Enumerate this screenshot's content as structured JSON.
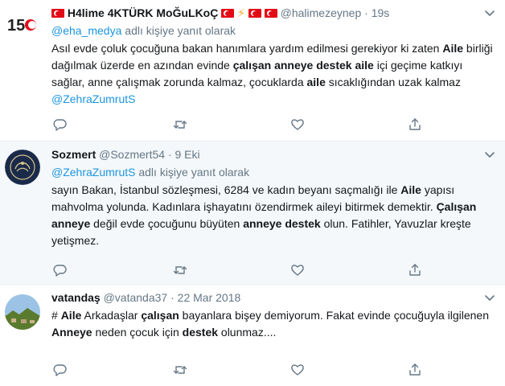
{
  "tweets": [
    {
      "name": "H4lime 4KTÜRK MoĞuLKoÇ",
      "handle": "@halimezeynep",
      "sep": "·",
      "time": "19s",
      "reply_prefix": "@eha_medya",
      "reply_suffix": " adlı kişiye yanıt olarak",
      "body": [
        {
          "t": "Asıl evde çoluk çocuğuna bakan hanımlara yardım edilmesi gerekiyor ki zaten "
        },
        {
          "b": "Aile"
        },
        {
          "t": " birliği dağılmak üzerde en azından evinde "
        },
        {
          "b": "çalışan anneye destek aile"
        },
        {
          "t": " içi geçime katkıyı sağlar, anne çalışmak zorunda kalmaz, çocuklarda "
        },
        {
          "b": "aile"
        },
        {
          "t": " sıcaklığından uzak kalmaz "
        },
        {
          "m": "@ZehraZumrutS"
        }
      ]
    },
    {
      "name": "Sozmert",
      "handle": "@Sozmert54",
      "sep": "·",
      "time": "9 Eki",
      "reply_prefix": "@ZehraZumrutS",
      "reply_suffix": " adlı kişiye yanıt olarak",
      "body": [
        {
          "t": "sayın Bakan, İstanbul sözleşmesi, 6284  ve kadın beyanı saçmalığı ile "
        },
        {
          "b": "Aile"
        },
        {
          "t": " yapısı mahvolma yolunda. Kadınlara işhayatını özendirmek aileyi bitirmek demektir. "
        },
        {
          "b": "Çalışan anneye"
        },
        {
          "t": " değil evde çocuğunu büyüten "
        },
        {
          "b": "anneye destek"
        },
        {
          "t": " olun. Fatihler, Yavuzlar kreşte yetişmez."
        }
      ]
    },
    {
      "name": "vatandaş",
      "handle": "@vatanda37",
      "sep": "·",
      "time": "22 Mar 2018",
      "body": [
        {
          "t": "# "
        },
        {
          "b": "Aile"
        },
        {
          "t": "        Arkadaşlar "
        },
        {
          "b": "çalışan"
        },
        {
          "t": " bayanlara bişey demiyorum. Fakat evinde çocuğuyla ilgilenen "
        },
        {
          "b": "Anneye"
        },
        {
          "t": " neden çocuk için "
        },
        {
          "b": "destek"
        },
        {
          "t": " olunmaz...."
        }
      ]
    }
  ],
  "icons": {
    "reply": "reply-icon",
    "retweet": "retweet-icon",
    "like": "heart-icon",
    "share": "share-icon",
    "more": "chevron-down-icon"
  },
  "colors": {
    "link": "#1b95e0",
    "muted": "#657786",
    "text": "#14171a",
    "highlight_bg": "#f5f8fa"
  }
}
